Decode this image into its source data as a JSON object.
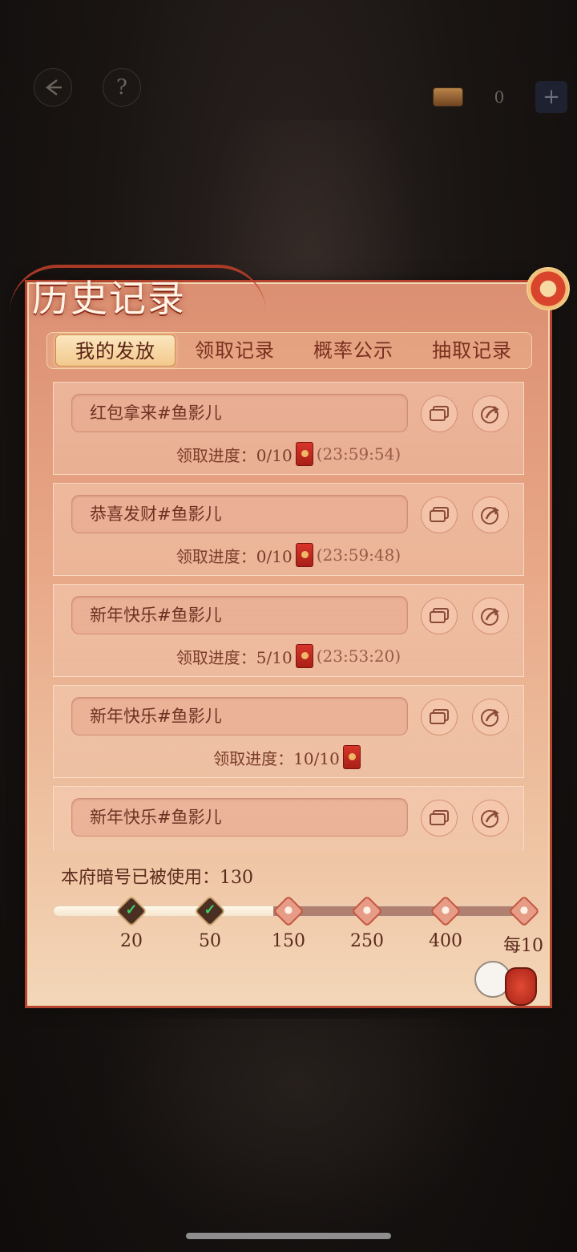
{
  "top_bar": {
    "back_icon": "back-arrow-icon",
    "help_symbol": "?",
    "coin_value": "0",
    "plus_symbol": "+"
  },
  "panel": {
    "title": "历史记录",
    "tabs": [
      {
        "label": "我的发放",
        "active": true
      },
      {
        "label": "领取记录",
        "active": false
      },
      {
        "label": "概率公示",
        "active": false
      },
      {
        "label": "抽取记录",
        "active": false
      }
    ],
    "records": [
      {
        "name": "红包拿来#鱼影儿",
        "progress": "领取进度：0/10",
        "timer": "(23:59:54)"
      },
      {
        "name": "恭喜发财#鱼影儿",
        "progress": "领取进度：0/10",
        "timer": "(23:59:48)"
      },
      {
        "name": "新年快乐#鱼影儿",
        "progress": "领取进度：5/10",
        "timer": "(23:53:20)"
      },
      {
        "name": "新年快乐#鱼影儿",
        "progress": "领取进度：10/10",
        "timer": ""
      },
      {
        "name": "新年快乐#鱼影儿",
        "progress": "",
        "timer": ""
      }
    ],
    "usage_label": "本府暗号已被使用：130",
    "usage_count": 130,
    "milestones": [
      {
        "label": "20",
        "done": true
      },
      {
        "label": "50",
        "done": true
      },
      {
        "label": "150",
        "done": false
      },
      {
        "label": "250",
        "done": false
      },
      {
        "label": "400",
        "done": false
      },
      {
        "label": "每10",
        "done": false
      }
    ],
    "progress_fraction": 0.46
  },
  "colors": {
    "panel_accent": "#b5432f",
    "tab_active": "#f2c98d",
    "check_green": "#3ed06a"
  }
}
